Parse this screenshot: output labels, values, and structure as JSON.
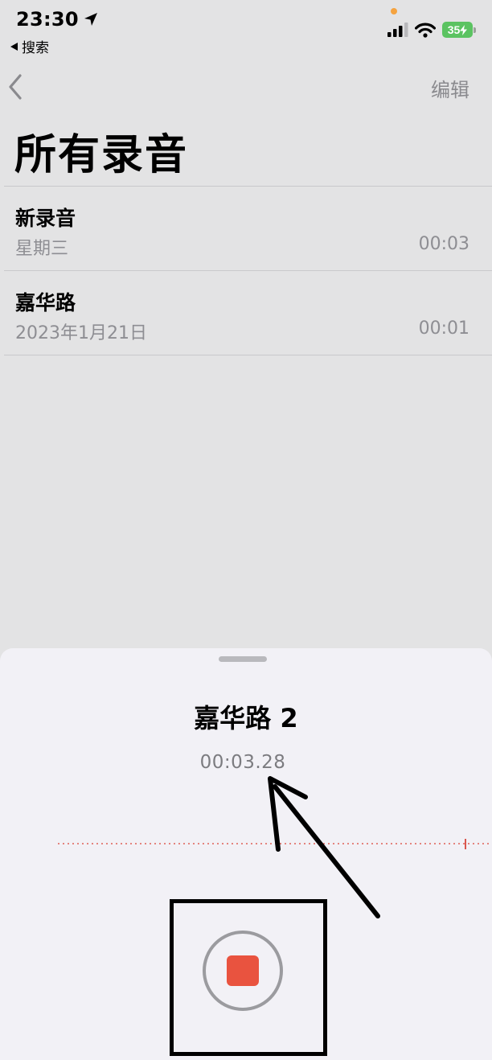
{
  "status_bar": {
    "time": "23:30",
    "back_app_label": "搜索",
    "battery_level": "35",
    "signal_bars": 3,
    "privacy_indicator_color": "#f5a340"
  },
  "nav": {
    "edit_label": "编辑"
  },
  "page_title": "所有录音",
  "recordings": [
    {
      "name": "新录音",
      "date": "星期三",
      "duration": "00:03"
    },
    {
      "name": "嘉华路",
      "date": "2023年1月21日",
      "duration": "00:01"
    }
  ],
  "recording_sheet": {
    "title": "嘉华路 2",
    "elapsed": "00:03.28",
    "stop_button_color": "#e9533f",
    "waveform_color": "#e0695f"
  },
  "icons": {
    "location": "location-arrow-icon",
    "back_app": "triangle-left-icon",
    "nav_back": "chevron-left-icon",
    "signal": "signal-bars-icon",
    "wifi": "wifi-icon",
    "battery": "battery-charging-icon",
    "stop": "stop-icon"
  }
}
